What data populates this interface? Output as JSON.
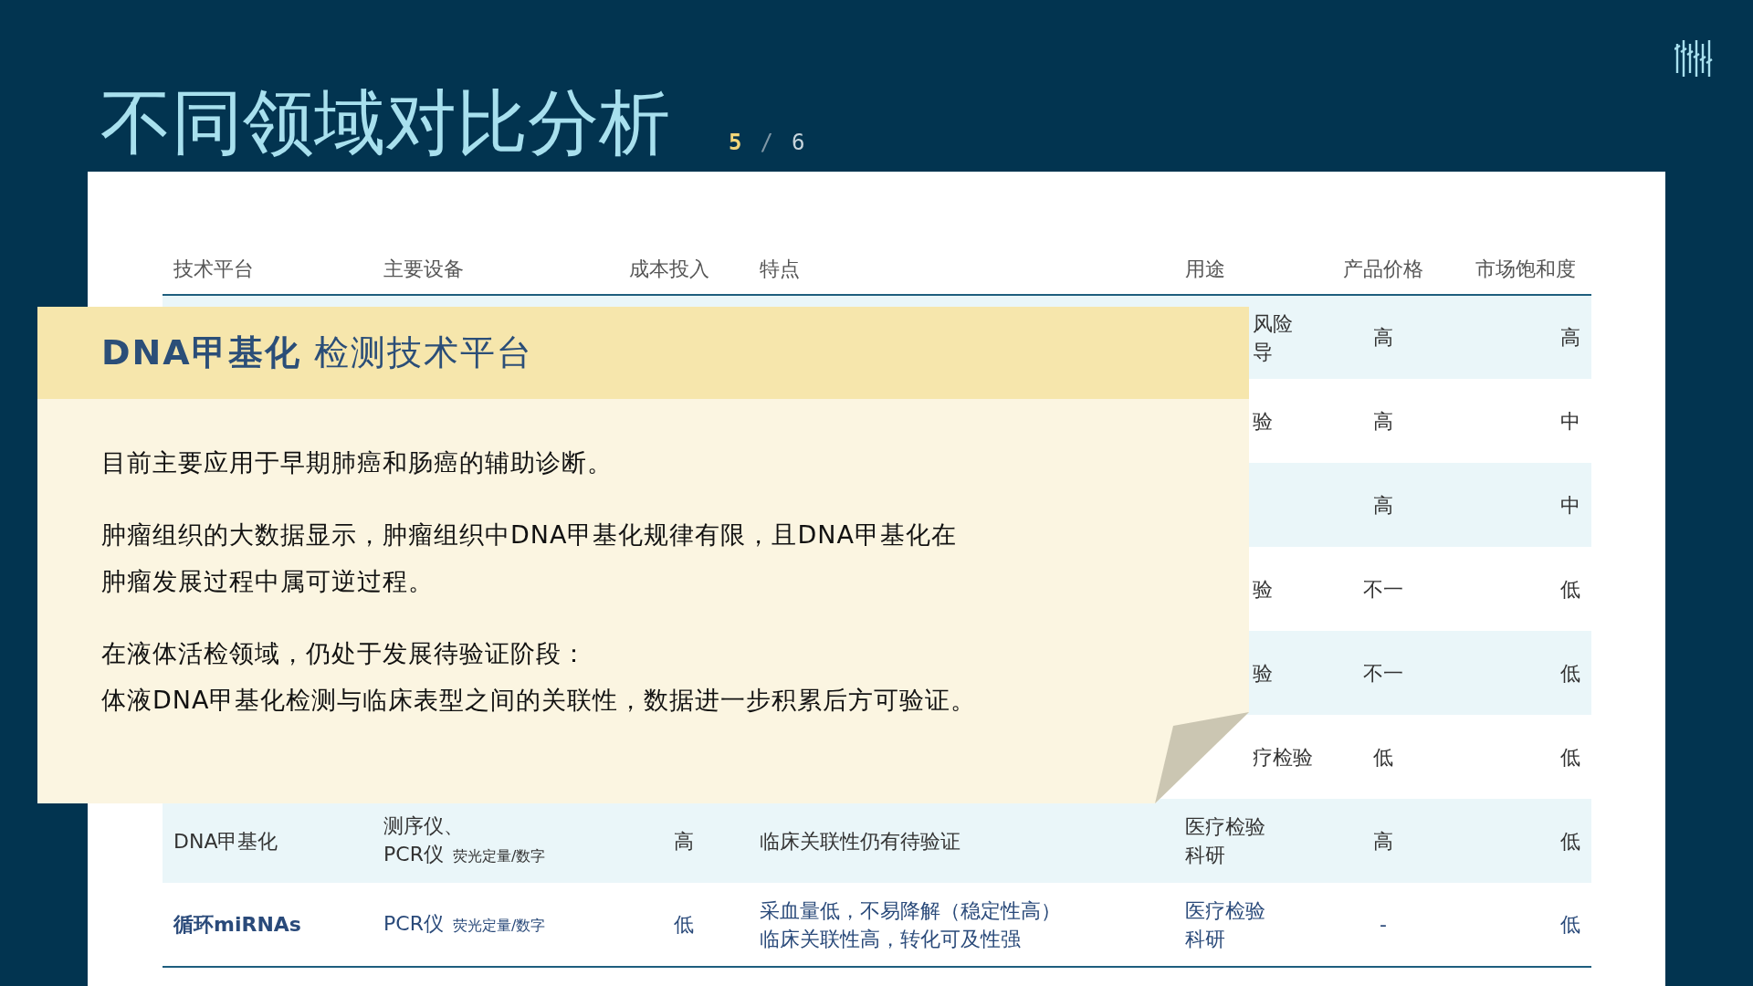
{
  "title": "不同领域对比分析",
  "page": {
    "current": "5",
    "separator": "/",
    "total": "6"
  },
  "table": {
    "columns": [
      "技术平台",
      "主要设备",
      "成本投入",
      "特点",
      "用途",
      "产品价格",
      "市场饱和度"
    ],
    "rows": [
      {
        "covered": true,
        "highlighted": false,
        "usage": [
          "风险",
          "导"
        ],
        "price": "高",
        "saturation": "高"
      },
      {
        "covered": true,
        "highlighted": false,
        "usage": [
          "验"
        ],
        "price": "高",
        "saturation": "中"
      },
      {
        "highlighted": false,
        "price": "高",
        "saturation": "中"
      },
      {
        "covered": true,
        "highlighted": false,
        "usage": [
          "验"
        ],
        "price": "不一",
        "saturation": "低"
      },
      {
        "covered": true,
        "highlighted": false,
        "usage": [
          "验"
        ],
        "price": "不一",
        "saturation": "低"
      },
      {
        "covered": true,
        "highlighted": false,
        "usage": [
          "疗检验"
        ],
        "price": "低",
        "saturation": "低"
      },
      {
        "covered": false,
        "highlighted": false,
        "platform": "DNA甲基化",
        "equipment": [
          {
            "main": "测序仪、"
          },
          {
            "main": "PCR仪",
            "note": "荧光定量/数字"
          }
        ],
        "cost": "高",
        "features": [
          "临床关联性仍有待验证"
        ],
        "usage": [
          "医疗检验",
          "科研"
        ],
        "price": "高",
        "saturation": "低"
      },
      {
        "covered": false,
        "highlighted": true,
        "platform": "循环miRNAs",
        "equipment": [
          {
            "main": "PCR仪",
            "note": "荧光定量/数字"
          }
        ],
        "cost": "低",
        "features": [
          "采血量低，不易降解（稳定性高）",
          "临床关联性高，转化可及性强"
        ],
        "usage": [
          "医疗检验",
          "科研"
        ],
        "price": "-",
        "saturation": "低"
      }
    ]
  },
  "popup": {
    "title": "**DNA甲基化** 检测技术平台",
    "paragraphs": [
      [
        "目前主要应用于早期肺癌和肠癌的辅助诊断。"
      ],
      [
        "肿瘤组织的大数据显示，肿瘤组织中DNA甲基化规律有限，且DNA甲基化在",
        "肿瘤发展过程中属可逆过程。"
      ],
      [
        "在液体活检领域，仍处于发展待验证阶段：",
        "体液DNA甲基化检测与临床表型之间的关联性，数据进一步积累后方可验证。"
      ]
    ]
  }
}
